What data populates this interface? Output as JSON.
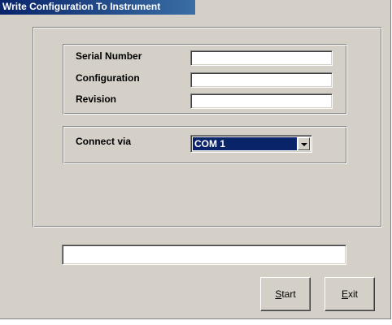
{
  "window": {
    "title": "Write Configuration To Instrument"
  },
  "instrument_group": {
    "serial_number_label": "Serial Number",
    "serial_number_value": "",
    "configuration_label": "Configuration",
    "configuration_value": "",
    "revision_label": "Revision",
    "revision_value": ""
  },
  "connection_group": {
    "connect_via_label": "Connect via",
    "connect_via_selected": "COM 1"
  },
  "status": {
    "message": ""
  },
  "buttons": {
    "start": {
      "accel": "S",
      "rest": "tart"
    },
    "exit": {
      "accel": "E",
      "rest": "xit"
    }
  },
  "icons": {
    "dropdown": "chevron-down-icon"
  },
  "colors": {
    "titlebar": "#0a246a",
    "face": "#d4d0c8",
    "selection": "#0a246a"
  }
}
